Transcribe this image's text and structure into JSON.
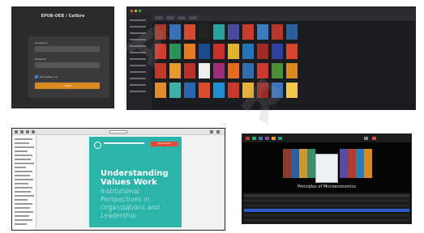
{
  "login": {
    "title": "EPUB-OEB / Calibre",
    "username_label": "Username",
    "password_label": "Password",
    "remember_label": "Remember me",
    "button_label": "LOGIN"
  },
  "viewer_book": {
    "title": "Understanding Values Work",
    "subtitle": "Institutional Perspectives in Organizations and Leadership",
    "badge": "Open Access"
  },
  "coverflow": {
    "caption": "Principles of Microeconomics"
  },
  "colors": {
    "accent_orange": "#d98a1e",
    "cover_teal": "#2bb5aa",
    "selection_blue": "#2f58c9"
  }
}
